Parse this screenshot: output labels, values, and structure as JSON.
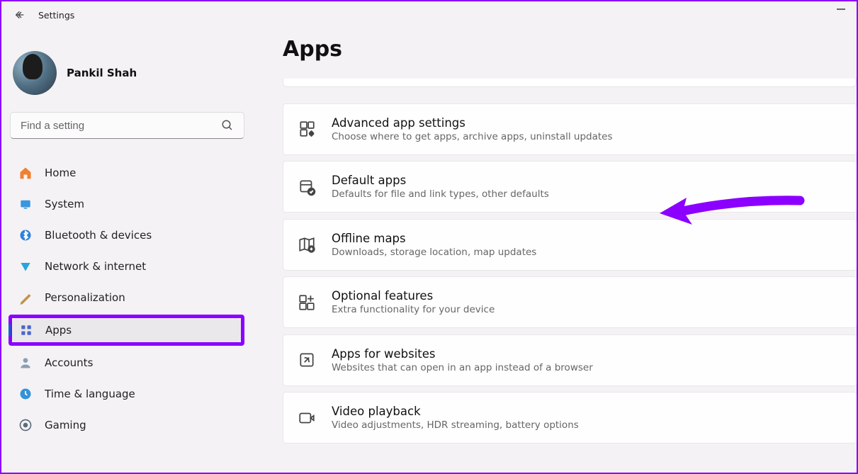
{
  "header": {
    "title": "Settings"
  },
  "user": {
    "name": "Pankil Shah"
  },
  "search": {
    "placeholder": "Find a setting"
  },
  "sidebar": {
    "items": [
      {
        "label": "Home"
      },
      {
        "label": "System"
      },
      {
        "label": "Bluetooth & devices"
      },
      {
        "label": "Network & internet"
      },
      {
        "label": "Personalization"
      },
      {
        "label": "Apps"
      },
      {
        "label": "Accounts"
      },
      {
        "label": "Time & language"
      },
      {
        "label": "Gaming"
      }
    ]
  },
  "main": {
    "title": "Apps",
    "cards": [
      {
        "title": "Advanced app settings",
        "sub": "Choose where to get apps, archive apps, uninstall updates"
      },
      {
        "title": "Default apps",
        "sub": "Defaults for file and link types, other defaults"
      },
      {
        "title": "Offline maps",
        "sub": "Downloads, storage location, map updates"
      },
      {
        "title": "Optional features",
        "sub": "Extra functionality for your device"
      },
      {
        "title": "Apps for websites",
        "sub": "Websites that can open in an app instead of a browser"
      },
      {
        "title": "Video playback",
        "sub": "Video adjustments, HDR streaming, battery options"
      }
    ]
  }
}
